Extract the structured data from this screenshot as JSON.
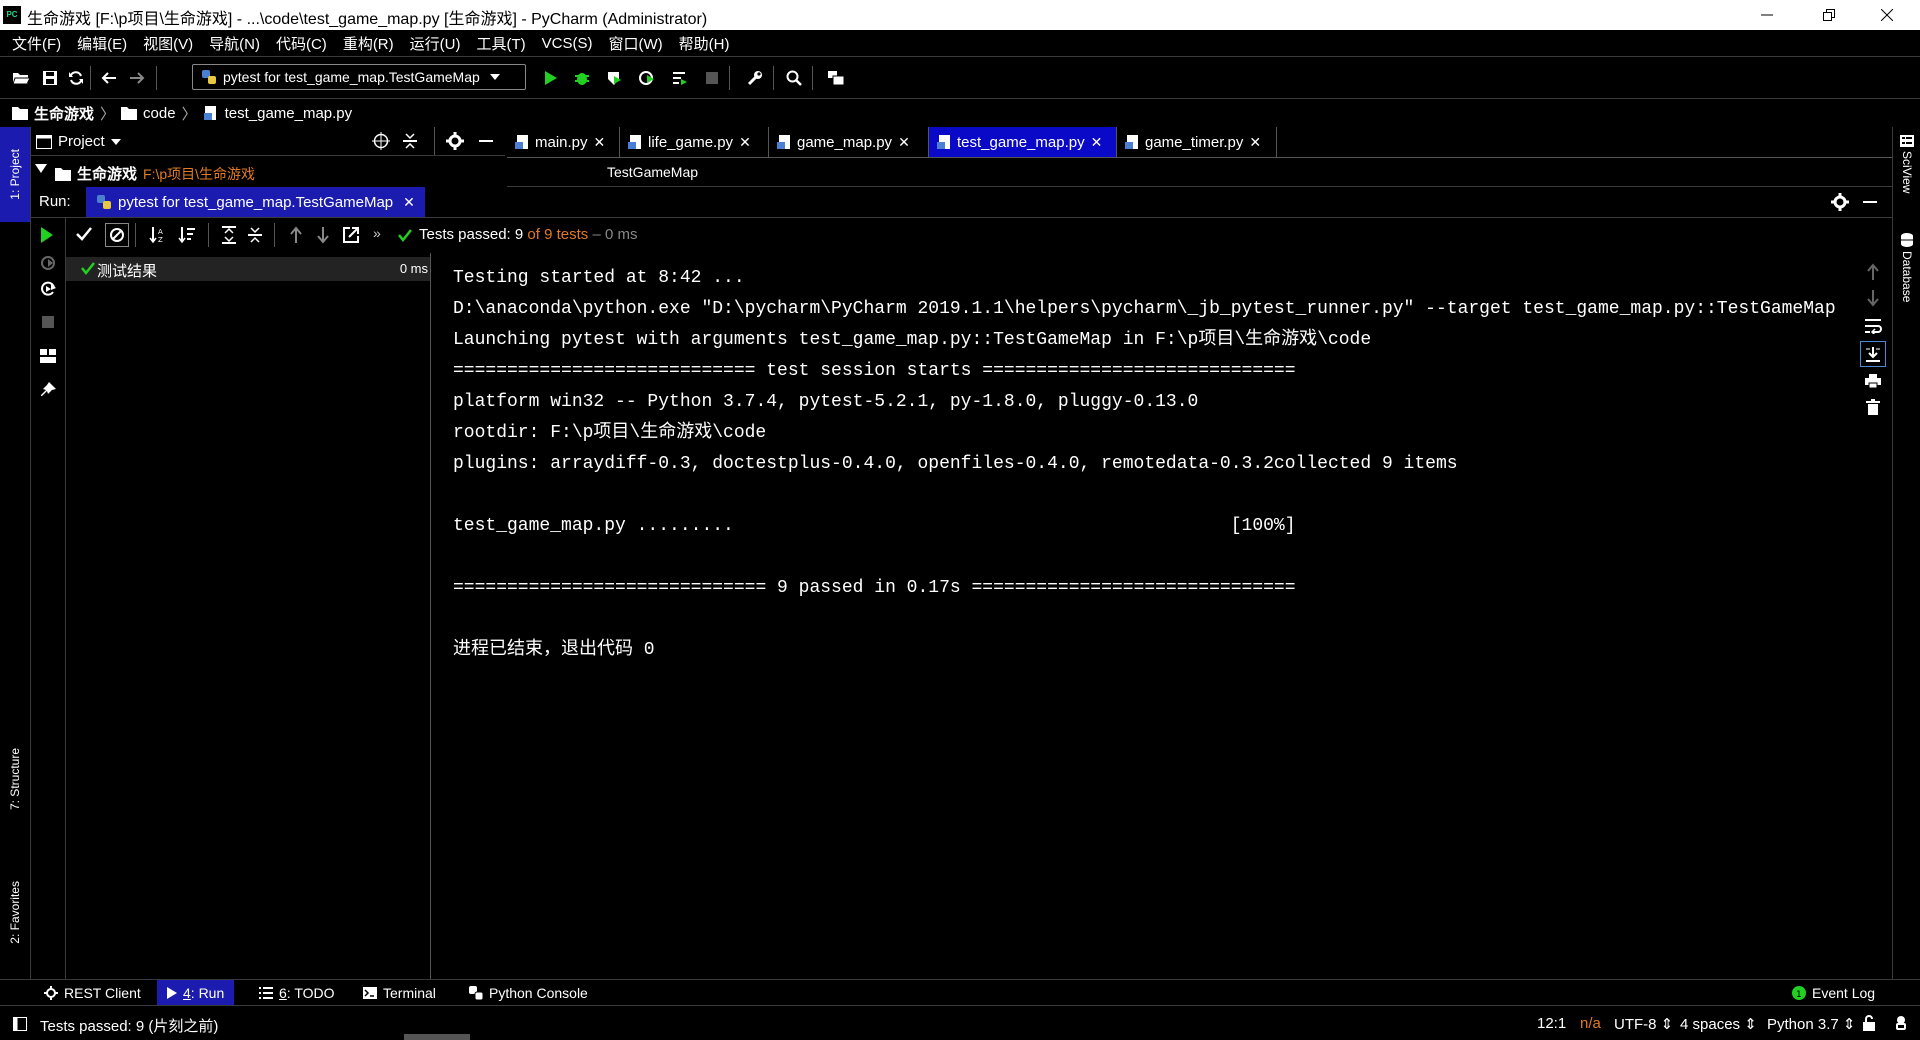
{
  "window": {
    "title": "生命游戏 [F:\\p项目\\生命游戏] - ...\\code\\test_game_map.py [生命游戏] - PyCharm (Administrator)",
    "app_icon": "PC",
    "controls": [
      "minimize-icon",
      "restore-icon",
      "close-icon"
    ]
  },
  "menu": [
    "文件(F)",
    "编辑(E)",
    "视图(V)",
    "导航(N)",
    "代码(C)",
    "重构(R)",
    "运行(U)",
    "工具(T)",
    "VCS(S)",
    "窗口(W)",
    "帮助(H)"
  ],
  "toolbar": {
    "run_config": "pytest for test_game_map.TestGameMap",
    "run_color": "#21d021",
    "debug_color": "#21d021"
  },
  "breadcrumb": [
    "生命游戏",
    "code",
    "test_game_map.py"
  ],
  "left_stripe": {
    "project": "1: Project",
    "structure": "7: Structure",
    "favorites": "2: Favorites"
  },
  "right_stripe": {
    "sciview": "SciView",
    "database": "Database"
  },
  "project_panel": {
    "title": "Project",
    "root_name": "生命游戏",
    "root_path": "F:\\p项目\\生命游戏",
    "path_color": "#e07b21"
  },
  "editor": {
    "tabs": [
      {
        "label": "main.py",
        "active": false
      },
      {
        "label": "life_game.py",
        "active": false
      },
      {
        "label": "game_map.py",
        "active": false
      },
      {
        "label": "test_game_map.py",
        "active": true
      },
      {
        "label": "game_timer.py",
        "active": false
      }
    ],
    "class_crumb": "TestGameMap"
  },
  "run": {
    "label": "Run:",
    "tab_label": "pytest for test_game_map.TestGameMap",
    "status_prefix": "Tests passed: ",
    "passed": "9",
    "of_text": " of ",
    "total": "9 tests",
    "sep": " – ",
    "duration": "0 ms",
    "count_color": "#e07b21"
  },
  "tree": {
    "root_label": "测试结果",
    "root_time": "0 ms"
  },
  "console": {
    "lines": [
      "Testing started at 8:42 ...",
      "D:\\anaconda\\python.exe \"D:\\pycharm\\PyCharm 2019.1.1\\helpers\\pycharm\\_jb_pytest_runner.py\" --target test_game_map.py::TestGameMap",
      "Launching pytest with arguments test_game_map.py::TestGameMap in F:\\p项目\\生命游戏\\code",
      "============================ test session starts =============================",
      "platform win32 -- Python 3.7.4, pytest-5.2.1, py-1.8.0, pluggy-0.13.0",
      "rootdir: F:\\p项目\\生命游戏\\code",
      "plugins: arraydiff-0.3, doctestplus-0.4.0, openfiles-0.4.0, remotedata-0.3.2collected 9 items",
      "",
      "test_game_map.py .........                                              [100%]",
      "",
      "============================= 9 passed in 0.17s ==============================",
      "",
      "进程已结束，退出代码 0"
    ]
  },
  "bottom_tabs": [
    {
      "num": "",
      "label": "REST Client",
      "active": false
    },
    {
      "num": "4",
      "label": ": Run",
      "active": true
    },
    {
      "num": "6",
      "label": ": TODO",
      "active": false
    },
    {
      "num": "",
      "label": "Terminal",
      "active": false
    },
    {
      "num": "",
      "label": "Python Console",
      "active": false
    }
  ],
  "event_log": "Event Log",
  "status": {
    "message": "Tests passed: 9 (片刻之前)",
    "position": "12:1",
    "na": "n/a",
    "encoding": "UTF-8 ⇕",
    "indent": "4 spaces ⇕",
    "interpreter": "Python 3.7 ⇕"
  }
}
